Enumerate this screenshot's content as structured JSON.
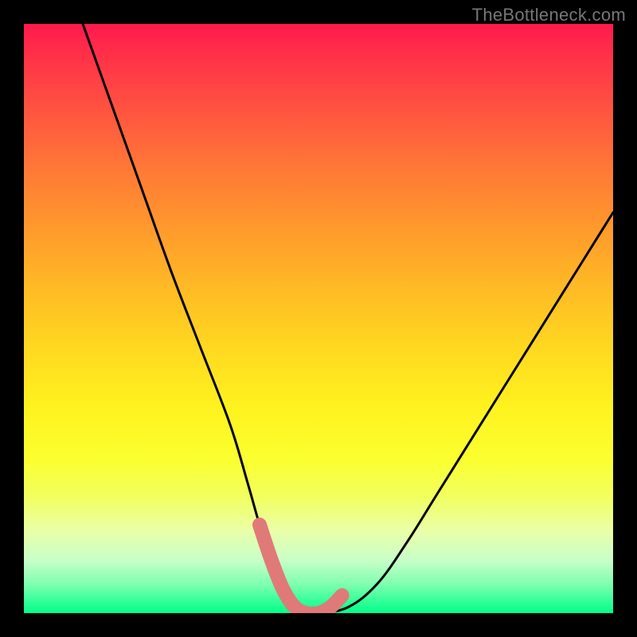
{
  "watermark": "TheBottleneck.com",
  "colors": {
    "frame": "#000000",
    "curve": "#000000",
    "marker": "#e07a78"
  },
  "chart_data": {
    "type": "line",
    "title": "",
    "xlabel": "",
    "ylabel": "",
    "xlim": [
      0,
      100
    ],
    "ylim": [
      0,
      100
    ],
    "grid": false,
    "legend": false,
    "series": [
      {
        "name": "bottleneck-curve",
        "x": [
          10,
          15,
          20,
          25,
          30,
          35,
          38,
          40,
          42,
          44,
          46,
          48,
          50,
          55,
          60,
          65,
          70,
          75,
          80,
          85,
          90,
          95,
          100
        ],
        "y": [
          100,
          86,
          72,
          58,
          45,
          32,
          22,
          15,
          9,
          4,
          1,
          0,
          0,
          1,
          5,
          12,
          20,
          28,
          36,
          44,
          52,
          60,
          68
        ]
      },
      {
        "name": "highlighted-min-segment",
        "x": [
          40,
          42,
          44,
          46,
          48,
          50,
          52,
          54
        ],
        "y": [
          15,
          9,
          4,
          1,
          0,
          0,
          1,
          3
        ]
      }
    ]
  }
}
